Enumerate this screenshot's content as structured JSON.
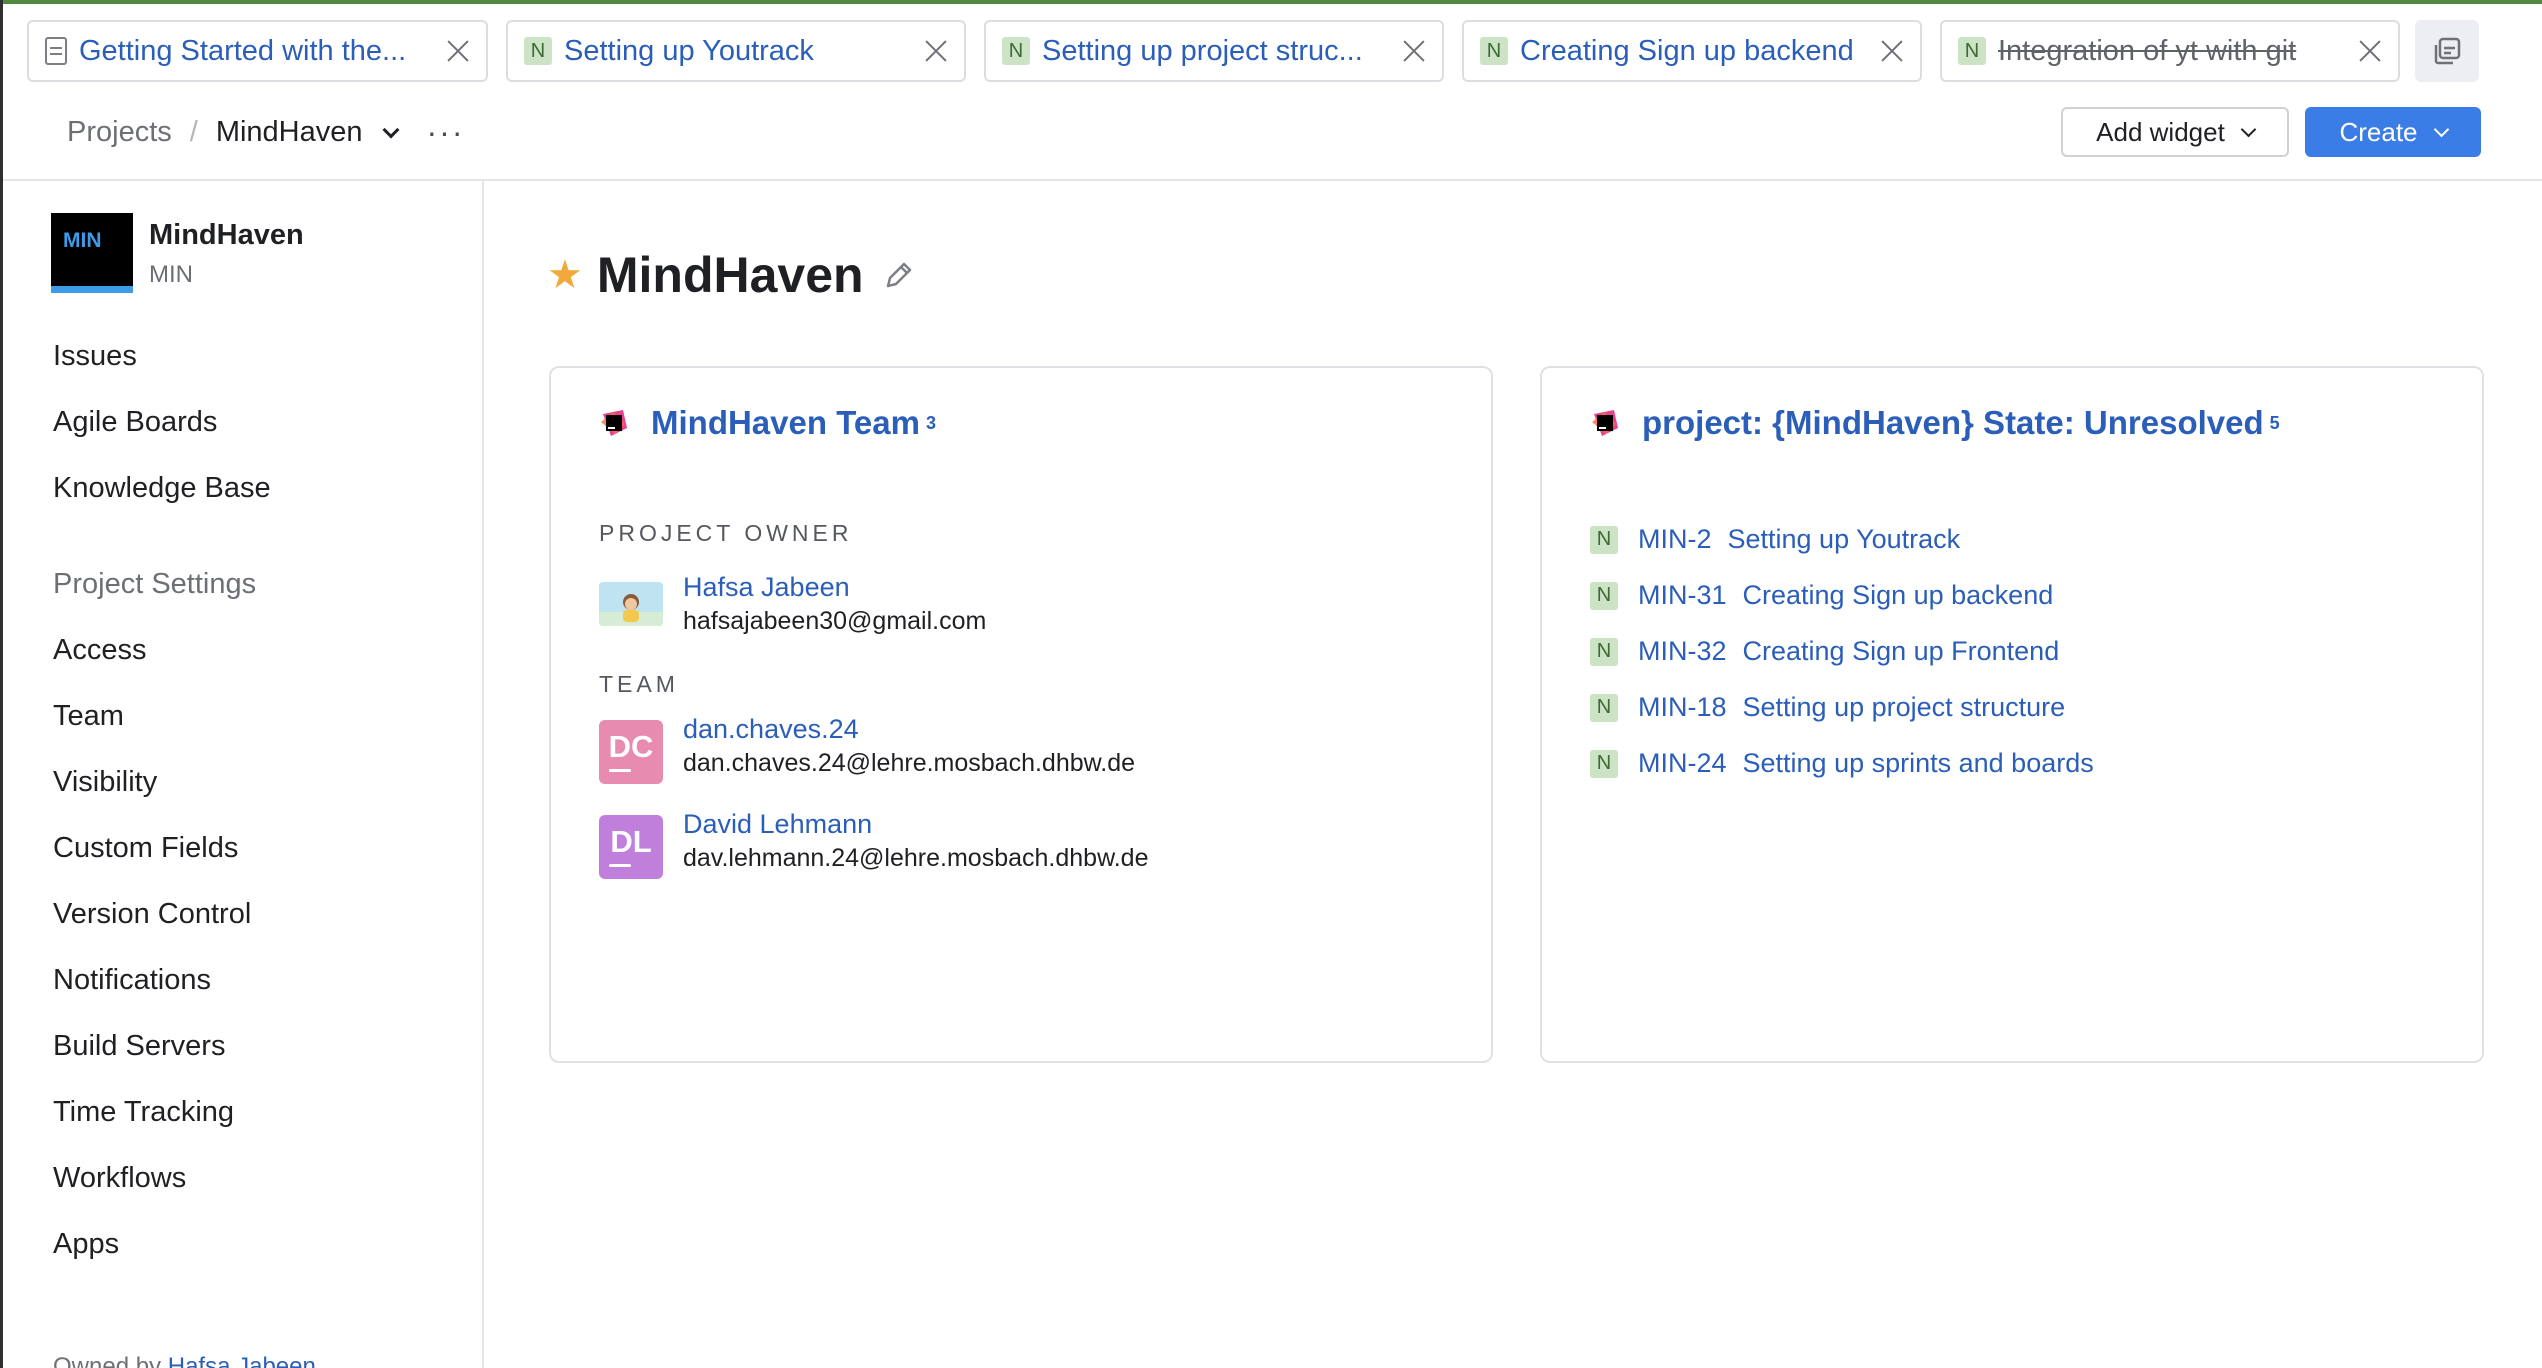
{
  "tabs": [
    {
      "label": "Getting Started with the...",
      "icon": "document-icon",
      "strikethrough": false
    },
    {
      "label": "Setting up Youtrack",
      "icon": "N",
      "strikethrough": false
    },
    {
      "label": "Setting up project struc...",
      "icon": "N",
      "strikethrough": false
    },
    {
      "label": "Creating Sign up backend",
      "icon": "N",
      "strikethrough": false
    },
    {
      "label": "Integration of yt with git",
      "icon": "N",
      "strikethrough": true
    }
  ],
  "breadcrumb": {
    "root": "Projects",
    "separator": "/",
    "current": "MindHaven",
    "more": "···"
  },
  "header": {
    "add_widget": "Add widget",
    "create": "Create"
  },
  "sidebar": {
    "logo_text": "MIN",
    "project_name": "MindHaven",
    "project_key": "MIN",
    "nav": [
      "Issues",
      "Agile Boards",
      "Knowledge Base"
    ],
    "settings_title": "Project Settings",
    "settings": [
      "Access",
      "Team",
      "Visibility",
      "Custom Fields",
      "Version Control",
      "Notifications",
      "Build Servers",
      "Time Tracking",
      "Workflows",
      "Apps"
    ],
    "owned_prefix": "Owned by",
    "owned_by": "Hafsa Jabeen"
  },
  "main": {
    "title": "MindHaven"
  },
  "team_card": {
    "title": "MindHaven Team",
    "count": "3",
    "owner_label": "PROJECT OWNER",
    "owner": {
      "name": "Hafsa Jabeen",
      "email": "hafsajabeen30@gmail.com"
    },
    "team_label": "TEAM",
    "members": [
      {
        "initials": "DC",
        "name": "dan.chaves.24",
        "email": "dan.chaves.24@lehre.mosbach.dhbw.de",
        "color": "#e88bb0"
      },
      {
        "initials": "DL",
        "name": "David Lehmann",
        "email": "dav.lehmann.24@lehre.mosbach.dhbw.de",
        "color": "#c07fdb"
      }
    ]
  },
  "issues_card": {
    "title": "project: {MindHaven} State: Unresolved",
    "count": "5",
    "issues": [
      {
        "badge": "N",
        "id": "MIN-2",
        "summary": "Setting up Youtrack"
      },
      {
        "badge": "N",
        "id": "MIN-31",
        "summary": "Creating Sign up backend"
      },
      {
        "badge": "N",
        "id": "MIN-32",
        "summary": "Creating Sign up Frontend"
      },
      {
        "badge": "N",
        "id": "MIN-18",
        "summary": "Setting up project structure"
      },
      {
        "badge": "N",
        "id": "MIN-24",
        "summary": "Setting up sprints and boards"
      }
    ]
  },
  "colors": {
    "accent": "#3b7de6",
    "link": "#2b5eb8",
    "star": "#f2a93b",
    "badge_bg": "#cde3c6"
  }
}
